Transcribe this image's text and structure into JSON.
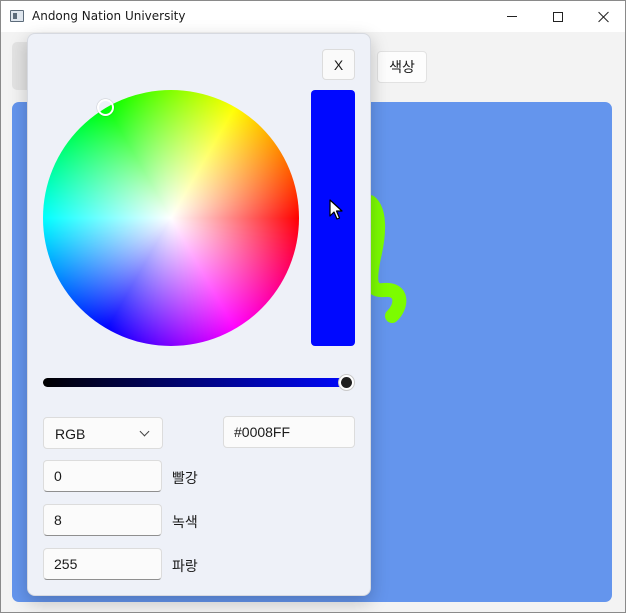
{
  "window": {
    "title": "Andong Nation University",
    "minimize_icon": "minimize-icon",
    "maximize_icon": "maximize-icon",
    "close_icon": "close-icon"
  },
  "toolbar": {
    "color_button_label": "색상"
  },
  "canvas": {
    "background_color": "#6495ED",
    "stroke_color": "#7CFC00"
  },
  "color_picker": {
    "close_label": "X",
    "selected_color": "#0008FF",
    "brightness_value": 1.0,
    "mode": {
      "selected": "RGB"
    },
    "hex_value": "#0008FF",
    "channels": {
      "red": {
        "value": "0",
        "label": "빨강"
      },
      "green": {
        "value": "8",
        "label": "녹색"
      },
      "blue": {
        "value": "255",
        "label": "파랑"
      }
    }
  }
}
